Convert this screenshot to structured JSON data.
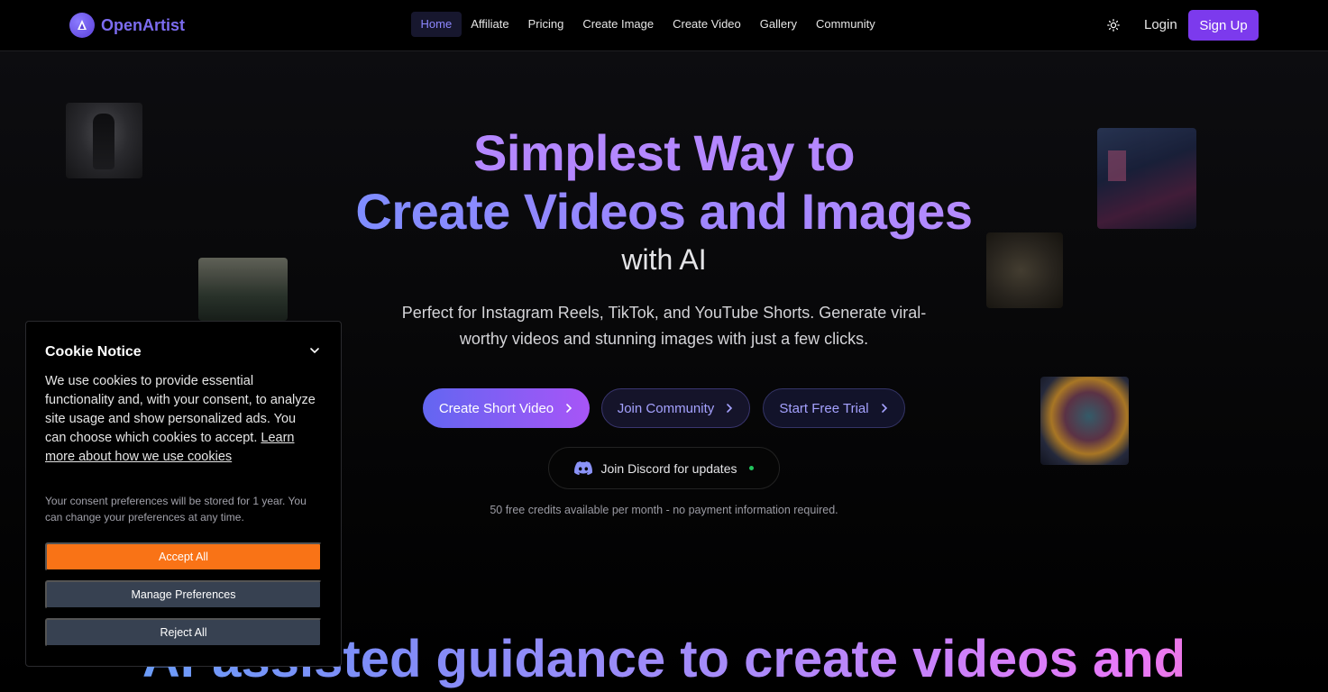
{
  "brand": {
    "name": "OpenArtist",
    "color": "#7c6cf0"
  },
  "nav": {
    "items": [
      {
        "label": "Home",
        "active": true
      },
      {
        "label": "Affiliate"
      },
      {
        "label": "Pricing"
      },
      {
        "label": "Create Image"
      },
      {
        "label": "Create Video"
      },
      {
        "label": "Gallery"
      },
      {
        "label": "Community"
      }
    ],
    "theme_icon": "sun-icon",
    "login": "Login",
    "signup": "Sign Up"
  },
  "hero": {
    "line1": "Simplest Way to",
    "line2": "Create Videos and Images",
    "line3": "with AI",
    "subtitle": "Perfect for Instagram Reels, TikTok, and YouTube Shorts. Generate viral-worthy videos and stunning images with just a few clicks.",
    "buttons": {
      "create_video": "Create Short Video",
      "join_community": "Join Community",
      "free_trial": "Start Free Trial"
    },
    "discord": "Join Discord for updates",
    "note": "50 free credits available per month - no payment information required."
  },
  "section": {
    "title": "AI-assisted guidance to create videos and"
  },
  "cookie": {
    "title": "Cookie Notice",
    "body": "We use cookies to provide essential functionality and, with your consent, to analyze site usage and show personalized ads. You can choose which cookies to accept.",
    "link": "Learn more about how we use cookies",
    "retention": "Your consent preferences will be stored for 1 year. You can change your preferences at any time.",
    "accept": "Accept All",
    "manage": "Manage Preferences",
    "reject": "Reject All"
  },
  "colors": {
    "accent": "#7c3aed",
    "accept": "#f97316",
    "secondary_btn": "#374151",
    "status_dot": "#22c55e"
  }
}
